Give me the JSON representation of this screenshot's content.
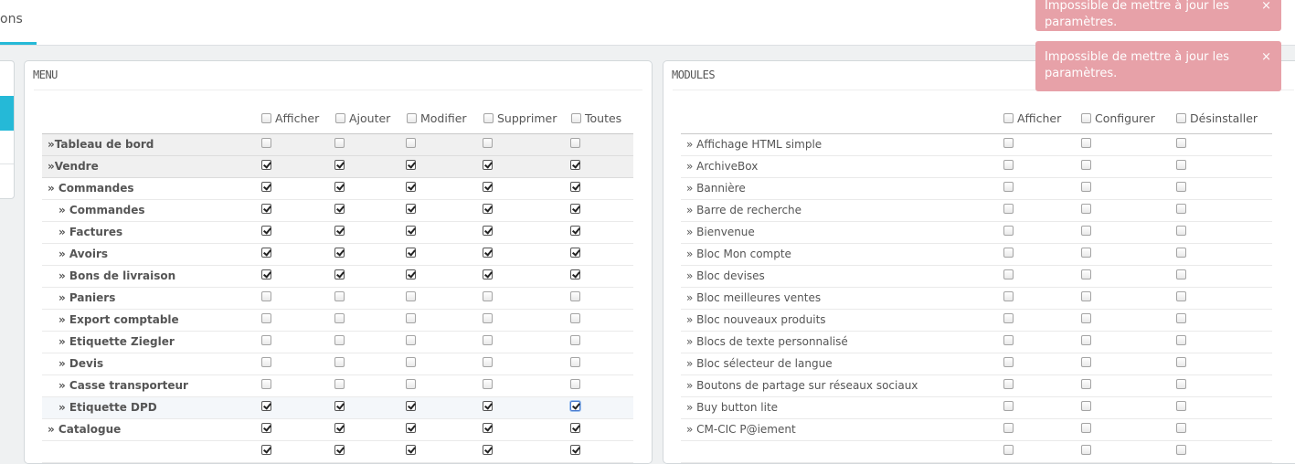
{
  "top_tab": {
    "label": "ons"
  },
  "menu_panel": {
    "title": "MENU",
    "headers": [
      "Afficher",
      "Ajouter",
      "Modifier",
      "Supprimer",
      "Toutes"
    ],
    "rows": [
      {
        "label": "»Tableau de bord",
        "checks": [
          false,
          false,
          false,
          false,
          false
        ]
      },
      {
        "label": "»Vendre",
        "checks": [
          true,
          true,
          true,
          true,
          true
        ]
      },
      {
        "label": "» Commandes",
        "checks": [
          true,
          true,
          true,
          true,
          true
        ]
      },
      {
        "label": "» Commandes",
        "checks": [
          true,
          true,
          true,
          true,
          true
        ]
      },
      {
        "label": "» Factures",
        "checks": [
          true,
          true,
          true,
          true,
          true
        ]
      },
      {
        "label": "» Avoirs",
        "checks": [
          true,
          true,
          true,
          true,
          true
        ]
      },
      {
        "label": "» Bons de livraison",
        "checks": [
          true,
          true,
          true,
          true,
          true
        ]
      },
      {
        "label": "» Paniers",
        "checks": [
          false,
          false,
          false,
          false,
          false
        ]
      },
      {
        "label": "» Export comptable",
        "checks": [
          false,
          false,
          false,
          false,
          false
        ]
      },
      {
        "label": "» Etiquette Ziegler",
        "checks": [
          false,
          false,
          false,
          false,
          false
        ]
      },
      {
        "label": "» Devis",
        "checks": [
          false,
          false,
          false,
          false,
          false
        ]
      },
      {
        "label": "» Casse transporteur",
        "checks": [
          false,
          false,
          false,
          false,
          false
        ]
      },
      {
        "label": "» Etiquette DPD",
        "checks": [
          true,
          true,
          true,
          true,
          true
        ]
      },
      {
        "label": "» Catalogue",
        "checks": [
          true,
          true,
          true,
          true,
          true
        ]
      },
      {
        "label": "",
        "checks": [
          true,
          true,
          true,
          true,
          true
        ]
      }
    ]
  },
  "modules_panel": {
    "title": "MODULES",
    "headers": [
      "Afficher",
      "Configurer",
      "Désinstaller"
    ],
    "rows": [
      {
        "label": "» Affichage HTML simple"
      },
      {
        "label": "» ArchiveBox"
      },
      {
        "label": "» Bannière"
      },
      {
        "label": "» Barre de recherche"
      },
      {
        "label": "» Bienvenue"
      },
      {
        "label": "» Bloc Mon compte"
      },
      {
        "label": "» Bloc devises"
      },
      {
        "label": "» Bloc meilleures ventes"
      },
      {
        "label": "» Bloc nouveaux produits"
      },
      {
        "label": "» Blocs de texte personnalisé"
      },
      {
        "label": "» Bloc sélecteur de langue"
      },
      {
        "label": "» Boutons de partage sur réseaux sociaux"
      },
      {
        "label": "» Buy button lite"
      },
      {
        "label": "» CM-CIC P@iement"
      },
      {
        "label": ""
      }
    ]
  },
  "toasts": [
    {
      "message": "Impossible de mettre à jour les paramètres.",
      "close": "×"
    },
    {
      "message": "Impossible de mettre à jour les paramètres.",
      "close": "×"
    }
  ],
  "colors": {
    "accent": "#25b9d7",
    "toast_bg": "#e7a1a8"
  }
}
